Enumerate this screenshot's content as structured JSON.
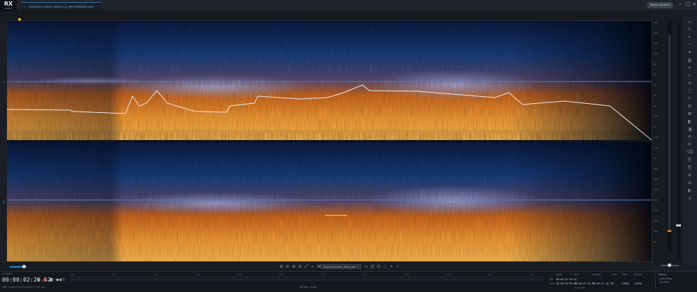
{
  "app": {
    "logo_text": "RX",
    "logo_sub": "iZotope",
    "file_tab": "melodyne_vocal_capture_2_selectedtakes.wav",
    "file_tab_close": "×",
    "open_file_button": "Repair Assistant"
  },
  "window": {
    "minimize": "–",
    "maximize": "□",
    "close": "×"
  },
  "tracks": {
    "left_label": "L",
    "right_label": "R"
  },
  "freq_scale": [
    "20k",
    "15k",
    "12k",
    "10k",
    "8k",
    "6k",
    "5k",
    "4k",
    "3k",
    "2.5k",
    "2k",
    "1.5k",
    "1.2k",
    "1k",
    "800",
    "600",
    "500",
    "400",
    "300",
    "200",
    "100",
    "50"
  ],
  "toolbar": {
    "mode_select": "Instant process: Attenuate",
    "mode_chevron": "▾"
  },
  "transport": {
    "clip_label": "Untitled",
    "timecode": "00:00:02:20.52",
    "status": "Edit: Loaded successfully (2.06 sec)",
    "rate_readout": "48 kHz, 24-bit",
    "buttons": [
      {
        "name": "play-button",
        "glyph": "▶"
      },
      {
        "name": "record-button",
        "glyph": "●"
      },
      {
        "name": "stop-button",
        "glyph": "■"
      },
      {
        "name": "rewind-button",
        "glyph": "◀◀"
      },
      {
        "name": "loop-button",
        "glyph": "↻"
      }
    ]
  },
  "selection": {
    "headers": [
      "Start",
      "End",
      "Length",
      "Low",
      "High",
      "Range"
    ],
    "row_sel_label": "Sel",
    "row_view_label": "View",
    "sel_start": "00:00:02:20.52",
    "view_start": "00:00:00:00.00",
    "view_end": "00:00:22:18.75",
    "view_length": "00:00:22:18.75",
    "view_low": "0",
    "view_high": "24000",
    "view_range": "24000",
    "units": "h:m:s.ms"
  },
  "history": {
    "title": "History",
    "items": [
      "Initial State",
      "Clip Gain"
    ]
  },
  "mini_ruler_ticks": [
    "0:00",
    "0:02",
    "0:04",
    "0:06",
    "0:08",
    "0:10",
    "0:12",
    "0:14",
    "0:16",
    "0:18",
    "0:20",
    "0:22"
  ],
  "tools": [
    "▭",
    "✎",
    "⌖",
    "◠",
    "✦",
    "▥",
    "⌗",
    "⊹",
    "≋",
    "⬚",
    "✂",
    "⊟",
    "⊠",
    "◧",
    "◨",
    "⟲",
    "⟳",
    "⌫",
    "⎘",
    "⎗",
    "⊕",
    "⊖",
    "◐",
    "⊿"
  ],
  "zoom_glyphs": [
    "⊕",
    "⊖",
    "⊕",
    "⊖",
    "⤢",
    "⌕",
    "⊞"
  ],
  "sel_glyphs": [
    {
      "glyph": "▭",
      "active": false
    },
    {
      "glyph": "◫",
      "active": false
    },
    {
      "glyph": "⊡",
      "active": false
    },
    {
      "glyph": "◌",
      "active": false
    },
    {
      "glyph": "⌖",
      "active": false
    },
    {
      "glyph": "✓",
      "active": true
    }
  ],
  "colors": {
    "accent": "#3aa0f0",
    "spectrum_hot": "#f5a53c",
    "spectrum_cold": "#0b1d45",
    "record": "#d85050"
  }
}
